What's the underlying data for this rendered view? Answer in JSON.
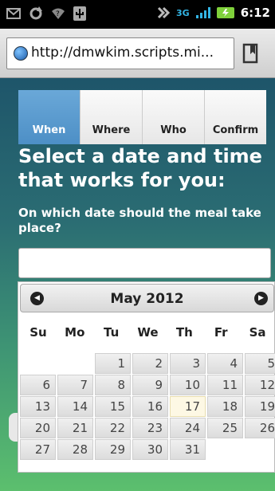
{
  "statusbar": {
    "icons_left": [
      "mail-icon",
      "sync-icon",
      "wifi-icon",
      "usb-icon"
    ],
    "network": "3G",
    "time": "6:12"
  },
  "browser": {
    "url": "http://dmwkim.scripts.mi..."
  },
  "tabs": [
    {
      "label": "When",
      "active": true
    },
    {
      "label": "Where",
      "active": false
    },
    {
      "label": "Who",
      "active": false
    },
    {
      "label": "Confirm",
      "active": false
    }
  ],
  "heading": "Select a date and time that works for you:",
  "question": "On which date should the meal take place?",
  "date_input": {
    "value": ""
  },
  "datepicker": {
    "month_title": "May 2012",
    "days_of_week": [
      "Su",
      "Mo",
      "Tu",
      "We",
      "Th",
      "Fr",
      "Sa"
    ],
    "leading_empty": 2,
    "days": [
      "1",
      "2",
      "3",
      "4",
      "5",
      "6",
      "7",
      "8",
      "9",
      "10",
      "11",
      "12",
      "13",
      "14",
      "15",
      "16",
      "17",
      "18",
      "19",
      "20",
      "21",
      "22",
      "23",
      "24",
      "25",
      "26",
      "27",
      "28",
      "29",
      "30",
      "31"
    ],
    "today": "17"
  },
  "colors": {
    "active_tab": "#4d8fc6",
    "today_highlight": "#fdf8e4"
  }
}
